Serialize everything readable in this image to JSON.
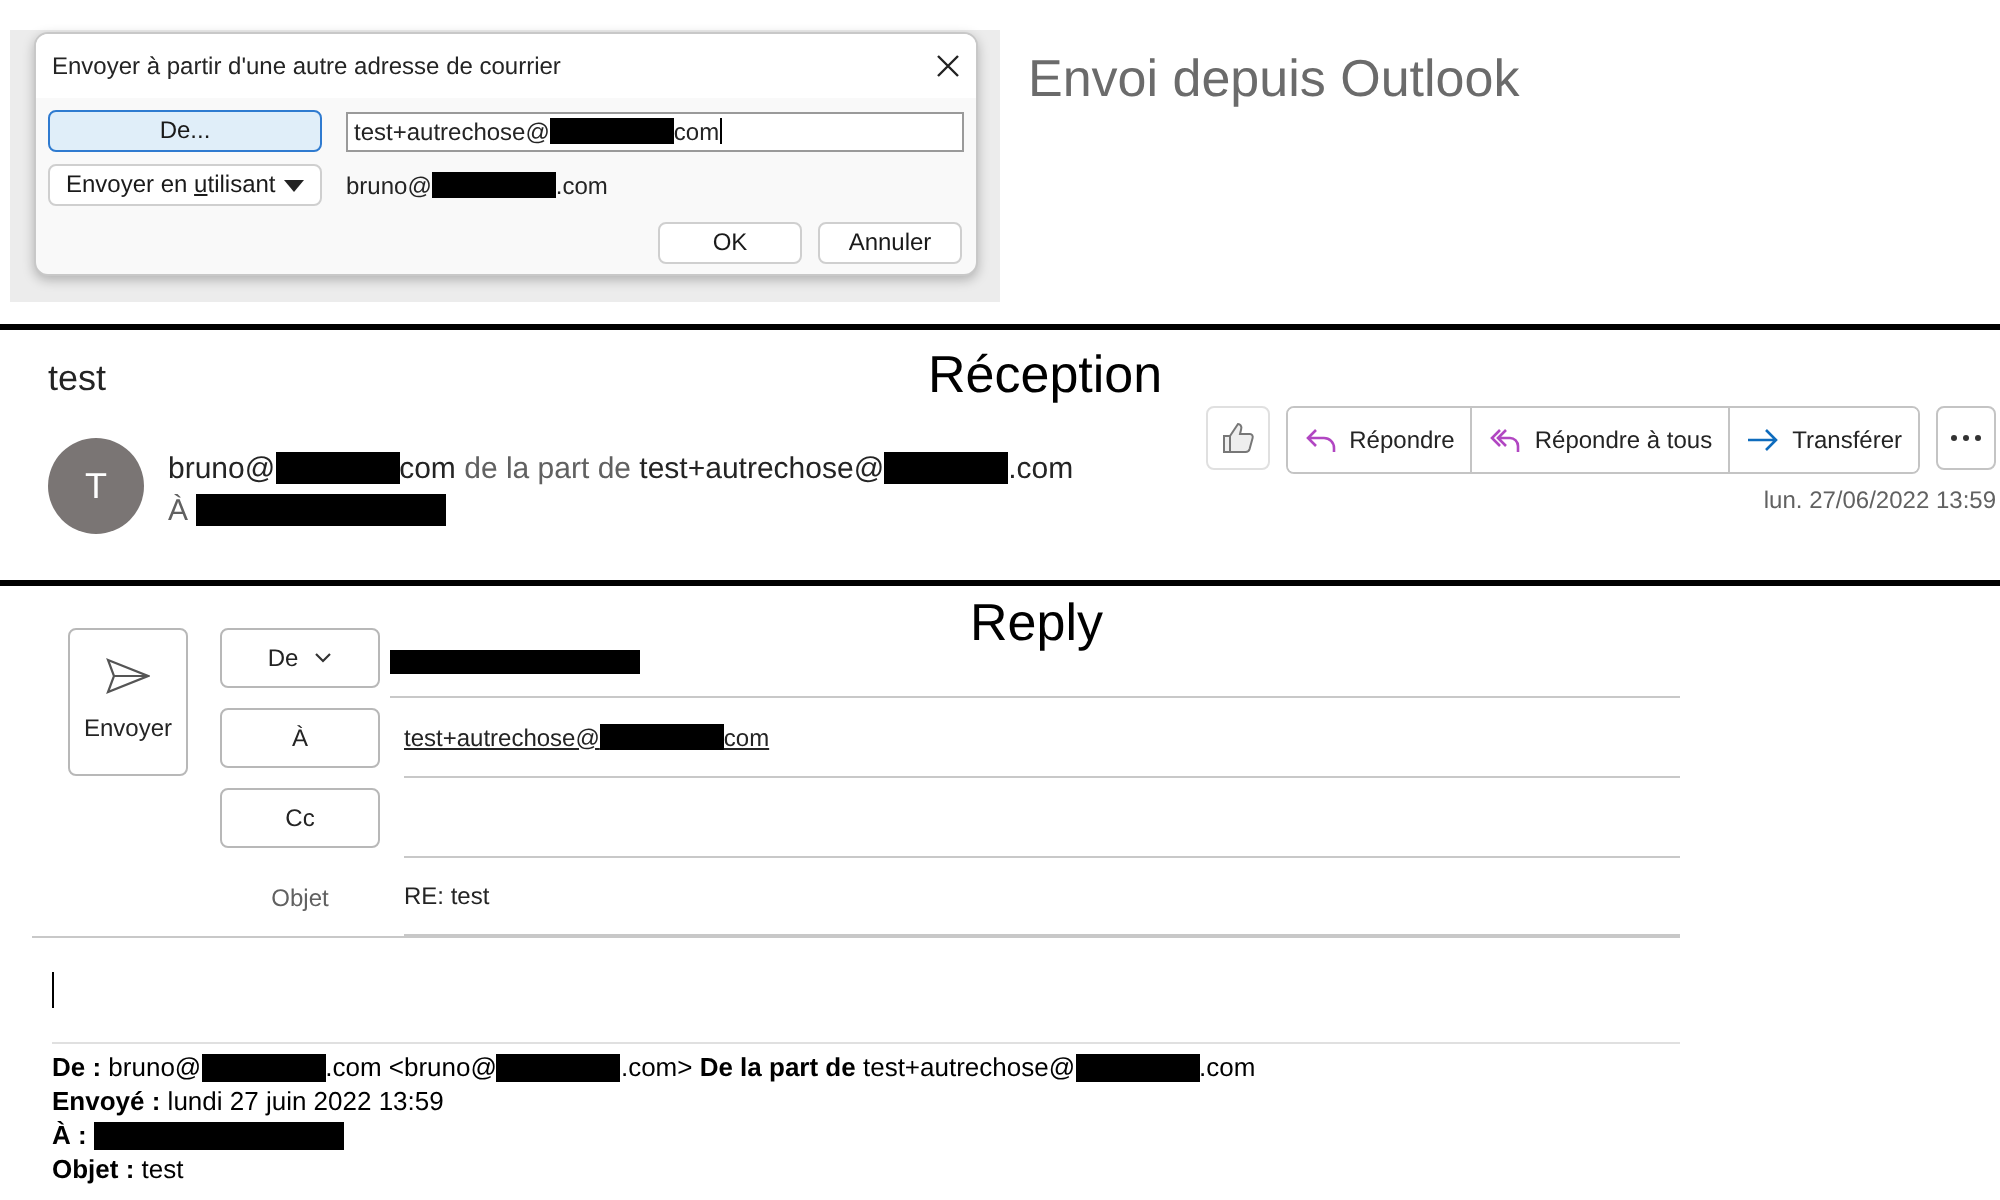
{
  "send_dialog": {
    "title": "Envoyer à partir d'une autre adresse de courrier",
    "from_button": "De...",
    "from_value": [
      {
        "kind": "text",
        "text": "test+autrechose@"
      },
      {
        "kind": "redacted"
      },
      {
        "kind": "text",
        "text": "com"
      }
    ],
    "send_using_button": {
      "before": "Envoyer en ",
      "key": "u",
      "after": "tilisant"
    },
    "account": [
      {
        "kind": "text",
        "text": "bruno@"
      },
      {
        "kind": "redacted"
      },
      {
        "kind": "text",
        "text": ".com"
      }
    ],
    "buttons": [
      "OK",
      "Annuler"
    ]
  },
  "caption": "Envoi depuis Outlook",
  "reception": {
    "heading": "Réception",
    "subject": "test",
    "avatar_initial": "T",
    "sender": [
      {
        "kind": "text",
        "text": "bruno@"
      },
      {
        "kind": "redacted"
      },
      {
        "kind": "text",
        "text": "com"
      },
      {
        "kind": "muted",
        "text": " de la part de "
      },
      {
        "kind": "text",
        "text": "test+autrechose@"
      },
      {
        "kind": "redacted"
      },
      {
        "kind": "text",
        "text": ".com"
      }
    ],
    "to": [
      {
        "kind": "muted",
        "text": "À "
      },
      {
        "kind": "redacted"
      }
    ],
    "actions": [
      "Répondre",
      "Répondre à tous",
      "Transférer"
    ],
    "date": "lun. 27/06/2022 13:59"
  },
  "reply": {
    "heading": "Reply",
    "send_button": "Envoyer",
    "fields": [
      {
        "button": "De",
        "dropdown": true,
        "value": [
          {
            "kind": "redacted"
          }
        ]
      },
      {
        "button": "À",
        "dropdown": false,
        "value": [
          {
            "kind": "link",
            "text": "test+autrechose@"
          },
          {
            "kind": "redacted"
          },
          {
            "kind": "link",
            "text": "com"
          }
        ]
      },
      {
        "button": "Cc",
        "dropdown": false
      }
    ],
    "subject_label": "Objet",
    "subject": "RE: test",
    "quoted_header": [
      [
        {
          "kind": "text",
          "text": "**De :** bruno@"
        },
        {
          "kind": "redacted"
        },
        {
          "kind": "text",
          "text": ".com <bruno@"
        },
        {
          "kind": "redacted"
        },
        {
          "kind": "text",
          "text": ".com> **De la part de** test+autrechose@"
        },
        {
          "kind": "redacted"
        },
        {
          "kind": "text",
          "text": ".com"
        }
      ],
      [
        {
          "kind": "text",
          "text": "**Envoyé :** lundi 27 juin 2022 13:59"
        }
      ],
      [
        {
          "kind": "text",
          "text": "**À :** "
        },
        {
          "kind": "redacted"
        }
      ],
      [
        {
          "kind": "text",
          "text": "**Objet :** test"
        }
      ]
    ]
  }
}
